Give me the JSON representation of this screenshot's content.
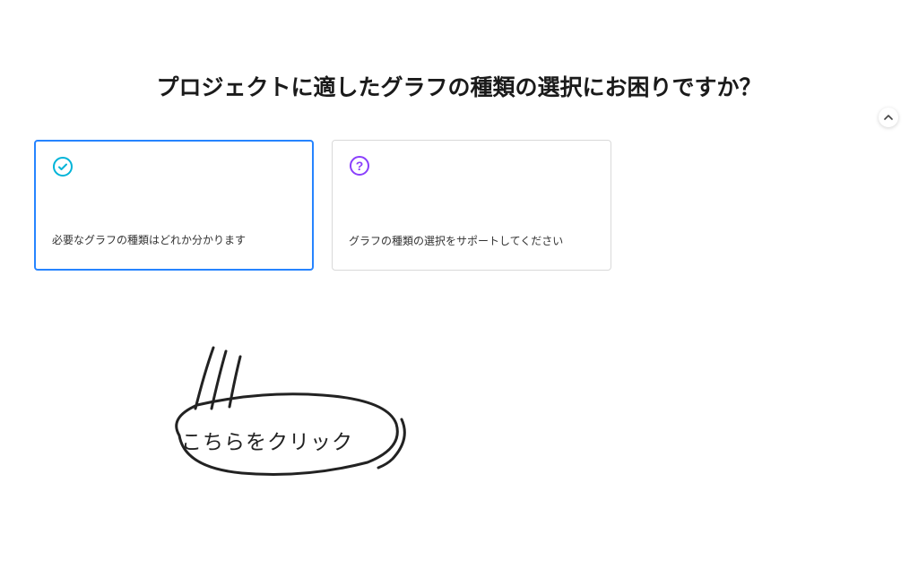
{
  "heading": "プロジェクトに適したグラフの種類の選択にお困りですか？",
  "options": {
    "know": "必要なグラフの種類はどれか分かります",
    "help": "グラフの種類の選択をサポートしてください"
  },
  "annotation": "こちらをクリック"
}
